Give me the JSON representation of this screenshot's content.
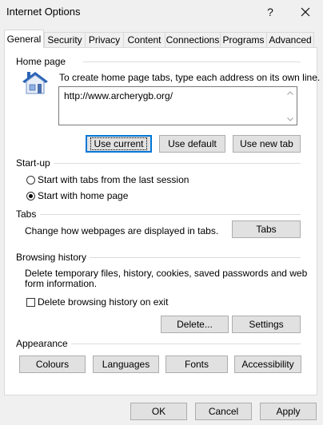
{
  "window": {
    "title": "Internet Options",
    "help_icon": "question-mark-icon",
    "close_icon": "close-icon"
  },
  "tabs": [
    {
      "label": "General",
      "active": true
    },
    {
      "label": "Security",
      "active": false
    },
    {
      "label": "Privacy",
      "active": false
    },
    {
      "label": "Content",
      "active": false
    },
    {
      "label": "Connections",
      "active": false
    },
    {
      "label": "Programs",
      "active": false
    },
    {
      "label": "Advanced",
      "active": false
    }
  ],
  "home_page": {
    "section_label": "Home page",
    "icon": "house-icon",
    "instructions": "To create home page tabs, type each address on its own line.",
    "url_value": "http://www.archerygb.org/",
    "use_current_label": "Use current",
    "use_default_label": "Use default",
    "use_new_tab_label": "Use new tab"
  },
  "startup": {
    "section_label": "Start-up",
    "option_last_session": "Start with tabs from the last session",
    "option_home_page": "Start with home page",
    "selected": "home_page"
  },
  "tabs_section": {
    "section_label": "Tabs",
    "description": "Change how webpages are displayed in tabs.",
    "button_label": "Tabs"
  },
  "browsing_history": {
    "section_label": "Browsing history",
    "description_line1": "Delete temporary files, history, cookies, saved passwords and web",
    "description_line2": "form information.",
    "delete_on_exit_label": "Delete browsing history on exit",
    "delete_on_exit_checked": false,
    "delete_button_label": "Delete...",
    "settings_button_label": "Settings"
  },
  "appearance": {
    "section_label": "Appearance",
    "colours_label": "Colours",
    "languages_label": "Languages",
    "fonts_label": "Fonts",
    "accessibility_label": "Accessibility"
  },
  "footer": {
    "ok_label": "OK",
    "cancel_label": "Cancel",
    "apply_label": "Apply"
  },
  "colors": {
    "focus_blue": "#0078d7",
    "button_bg": "#e1e1e1",
    "button_border": "#adadad",
    "house_roof": "#2a64b6",
    "house_wall": "#e8eef7"
  }
}
